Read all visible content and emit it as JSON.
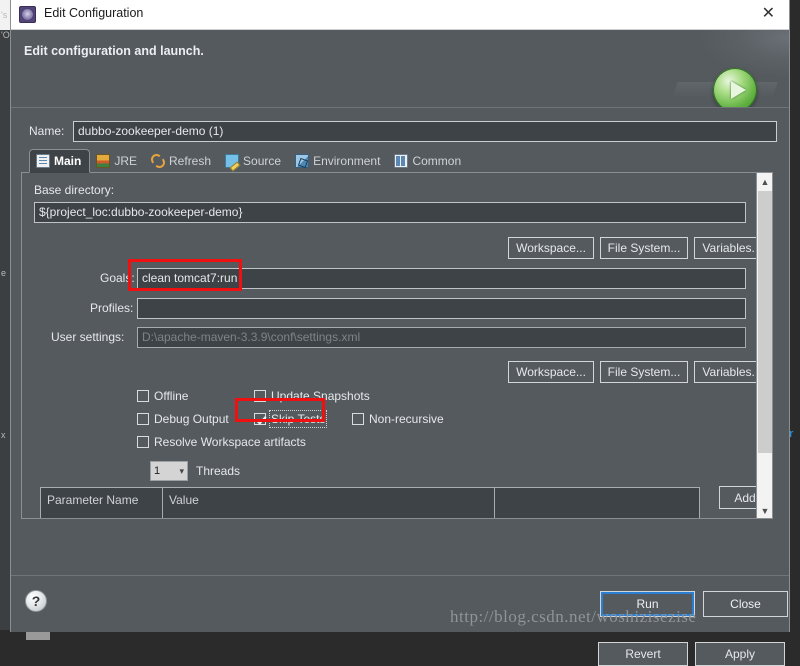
{
  "window": {
    "title": "Edit Configuration",
    "icon": "gear-icon",
    "close_label": "✕"
  },
  "banner": {
    "title": "Edit configuration and launch.",
    "icon": "run-play-icon"
  },
  "name_field": {
    "label": "Name:",
    "value": "dubbo-zookeeper-demo (1)"
  },
  "tabs": [
    {
      "label": "Main",
      "icon": "main-tab-icon",
      "active": true
    },
    {
      "label": "JRE",
      "icon": "jre-tab-icon",
      "active": false
    },
    {
      "label": "Refresh",
      "icon": "refresh-tab-icon",
      "active": false
    },
    {
      "label": "Source",
      "icon": "source-tab-icon",
      "active": false
    },
    {
      "label": "Environment",
      "icon": "environment-tab-icon",
      "active": false
    },
    {
      "label": "Common",
      "icon": "common-tab-icon",
      "active": false
    }
  ],
  "main": {
    "base_directory": {
      "label": "Base directory:",
      "value": "${project_loc:dubbo-zookeeper-demo}"
    },
    "base_buttons": [
      {
        "label": "Workspace...",
        "mnemonic": "W"
      },
      {
        "label": "File System...",
        "mnemonic": "m"
      },
      {
        "label": "Variables...",
        "mnemonic": "V"
      }
    ],
    "goals": {
      "label": "Goals:",
      "value": "clean tomcat7:run",
      "highlighted": true
    },
    "profiles": {
      "label": "Profiles:",
      "value": ""
    },
    "user_settings": {
      "label": "User settings:",
      "value": "",
      "placeholder": "D:\\apache-maven-3.3.9\\conf\\settings.xml"
    },
    "settings_buttons": [
      {
        "label": "Workspace...",
        "mnemonic": "W"
      },
      {
        "label": "File System...",
        "mnemonic": "m"
      },
      {
        "label": "Variables...",
        "mnemonic": "V"
      }
    ],
    "checkboxes": [
      {
        "label": "Offline",
        "checked": false,
        "highlighted": false
      },
      {
        "label": "Update Snapshots",
        "checked": false,
        "highlighted": false
      },
      {
        "label": "Debug Output",
        "checked": false,
        "highlighted": false
      },
      {
        "label": "Skip Tests",
        "checked": true,
        "highlighted": true
      },
      {
        "label": "Non-recursive",
        "checked": false,
        "highlighted": false
      },
      {
        "label": "Resolve Workspace artifacts",
        "checked": false,
        "highlighted": false
      }
    ],
    "threads": {
      "value": "1",
      "label": "Threads"
    },
    "parameter_table": {
      "columns": [
        "Parameter Name",
        "Value",
        ""
      ],
      "rows": []
    },
    "add_button": {
      "label": "Add...",
      "mnemonic": "A"
    },
    "scrollbar": {
      "up": "▲",
      "down": "▼"
    }
  },
  "actions": {
    "revert": "Revert",
    "apply": "Apply",
    "run": "Run",
    "close": "Close",
    "help": "?"
  },
  "watermark": "http://blog.csdn.net/woshizisezise",
  "background": {
    "left_fragments": [
      "'s",
      "'O",
      "e",
      "x"
    ],
    "right_fragment": "r"
  },
  "colors": {
    "dialog_bg": "#555a5e",
    "field_bg": "#3e4347",
    "accent_focus": "#2a7fd4",
    "annotation": "#f01010",
    "run_green": "#62b241"
  }
}
